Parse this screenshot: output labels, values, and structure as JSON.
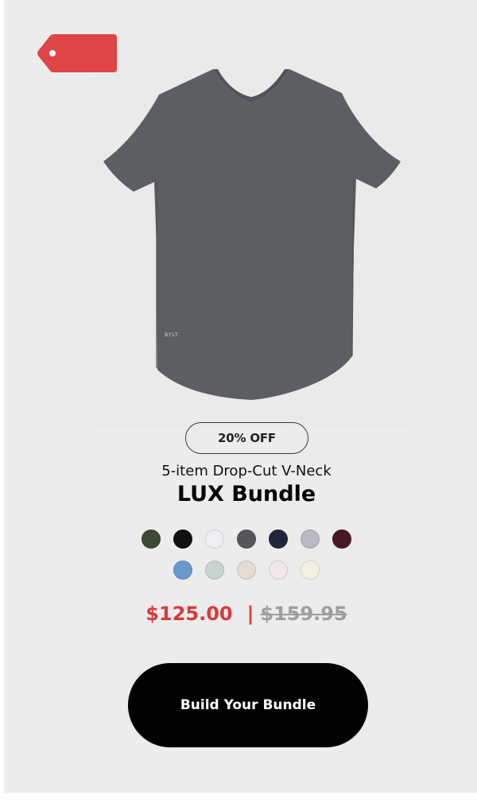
{
  "badge": {
    "label": "20% OFF"
  },
  "product": {
    "subtitle": "5-item Drop-Cut V-Neck",
    "title": "LUX Bundle",
    "shirt_brand_text": "BYLT",
    "shirt_color": "#5b5f64"
  },
  "colors": {
    "tag": "#e04545",
    "sale_price": "#d83a3a",
    "original_price": "#9e9e9e",
    "cta_bg": "#000000"
  },
  "swatches": {
    "row1": [
      "#3d4a33",
      "#111114",
      "#eeeff2",
      "#55575b",
      "#22263a",
      "#b8b9c4",
      "#4a1724"
    ],
    "row2": [
      "#6b98cc",
      "#c8d4cf",
      "#e5dbd2",
      "#f2e6e8",
      "#f3f1e0"
    ]
  },
  "price": {
    "sale": "$125.00",
    "separator": "|",
    "original": "$159.95"
  },
  "cta": {
    "label": "Build Your Bundle"
  }
}
